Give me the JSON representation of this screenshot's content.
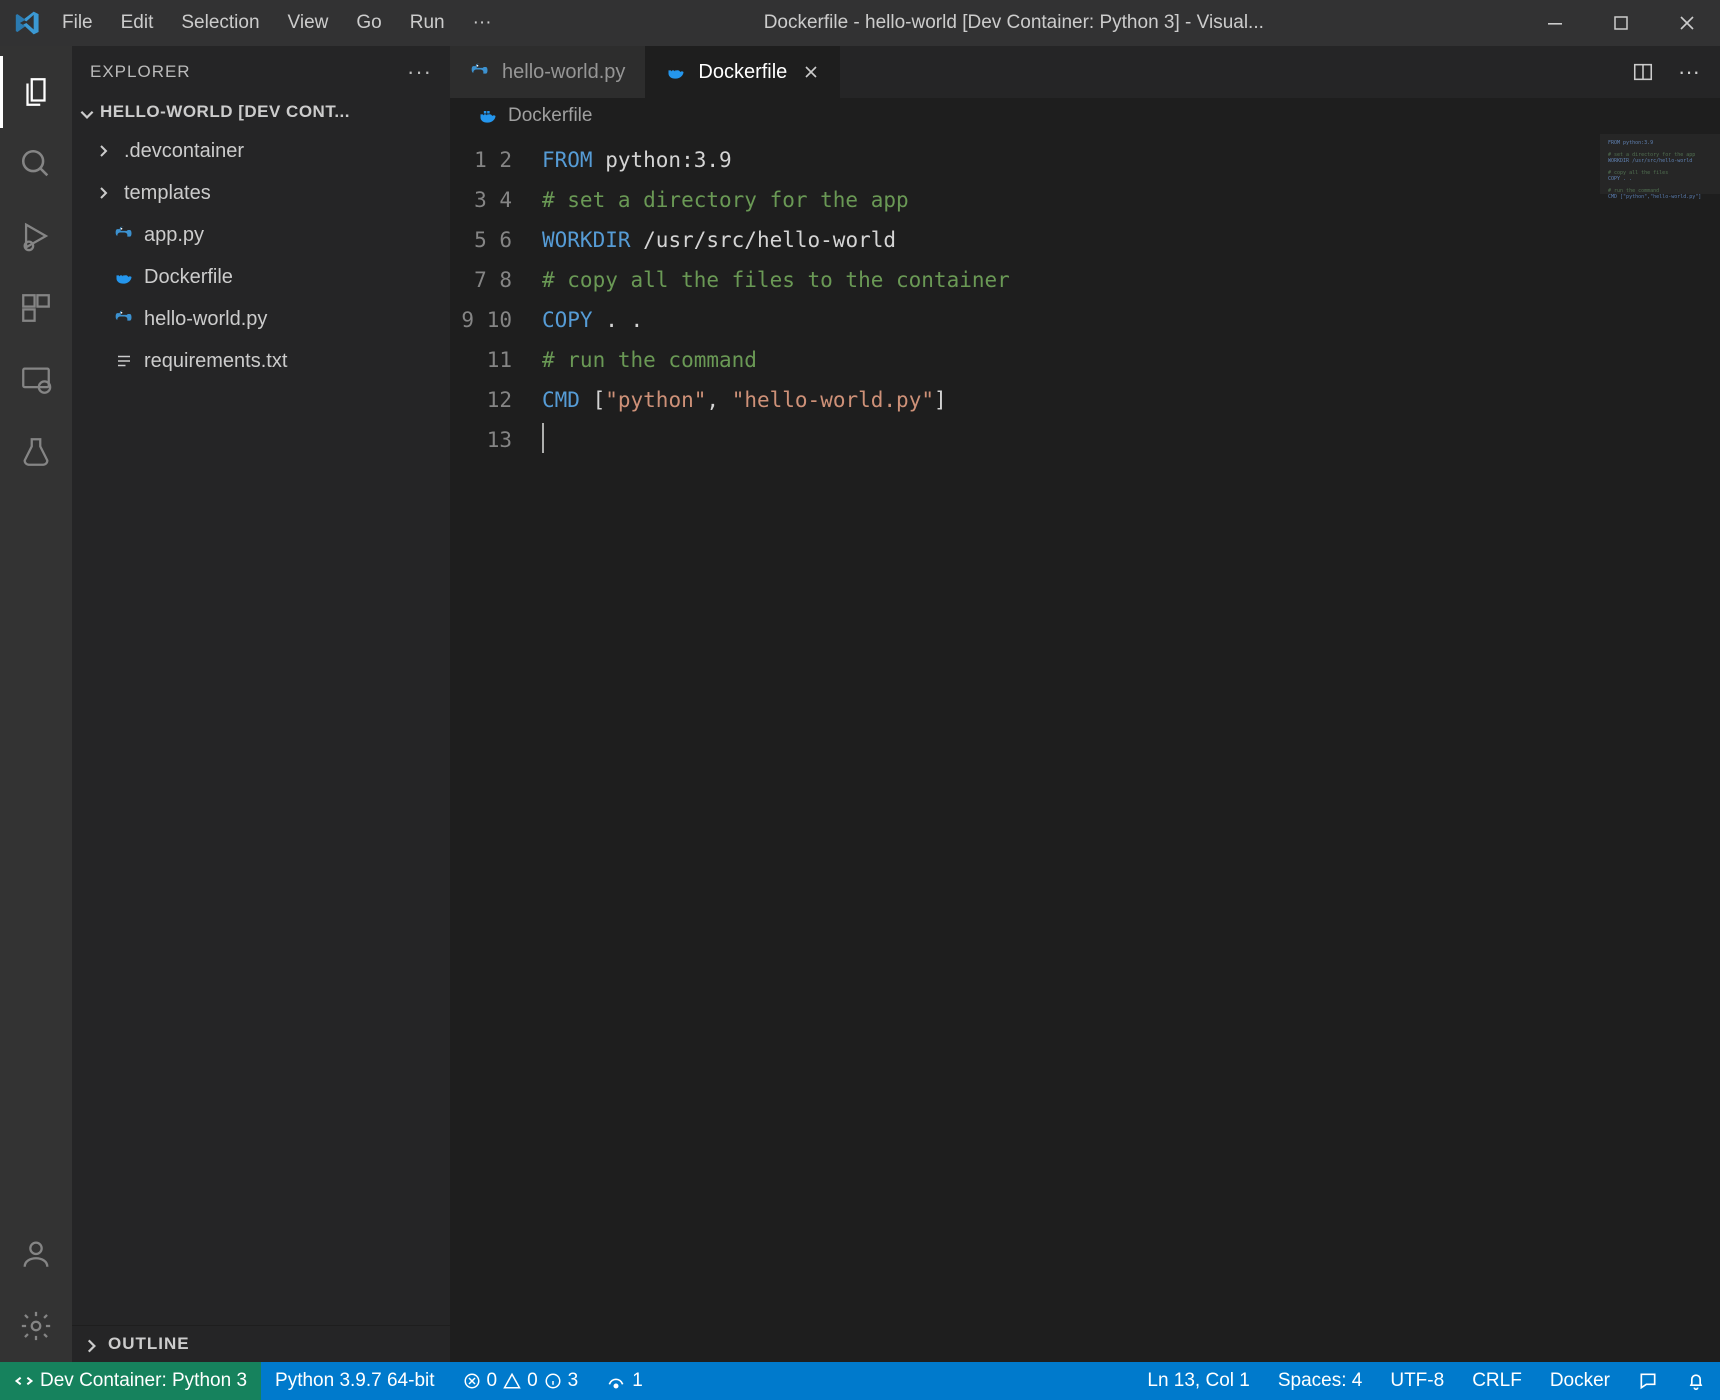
{
  "window": {
    "title": "Dockerfile - hello-world [Dev Container: Python 3] - Visual..."
  },
  "menu": [
    "File",
    "Edit",
    "Selection",
    "View",
    "Go",
    "Run",
    "···"
  ],
  "explorer": {
    "title": "EXPLORER",
    "project": "HELLO-WORLD [DEV CONT...",
    "items": [
      {
        "label": ".devcontainer",
        "kind": "folder"
      },
      {
        "label": "templates",
        "kind": "folder"
      },
      {
        "label": "app.py",
        "kind": "python"
      },
      {
        "label": "Dockerfile",
        "kind": "docker"
      },
      {
        "label": "hello-world.py",
        "kind": "python"
      },
      {
        "label": "requirements.txt",
        "kind": "lines"
      }
    ],
    "outline": "OUTLINE"
  },
  "tabs": [
    {
      "label": "hello-world.py",
      "kind": "python",
      "active": false
    },
    {
      "label": "Dockerfile",
      "kind": "docker",
      "active": true
    }
  ],
  "breadcrumb": {
    "kind": "docker",
    "label": "Dockerfile"
  },
  "code": {
    "total_lines": 13,
    "lines": [
      [
        {
          "t": "FROM",
          "c": "kw"
        },
        {
          "t": " python:3.9",
          "c": ""
        }
      ],
      [],
      [
        {
          "t": "# set a directory for the app",
          "c": "cmt"
        }
      ],
      [
        {
          "t": "WORKDIR",
          "c": "kw"
        },
        {
          "t": " /usr/src/hello-world",
          "c": ""
        }
      ],
      [],
      [
        {
          "t": "# copy all the files to the container",
          "c": "cmt"
        }
      ],
      [
        {
          "t": "COPY",
          "c": "kw"
        },
        {
          "t": " . .",
          "c": ""
        }
      ],
      [],
      [
        {
          "t": "# run the command",
          "c": "cmt"
        }
      ],
      [
        {
          "t": "CMD",
          "c": "kw"
        },
        {
          "t": " [",
          "c": ""
        },
        {
          "t": "\"python\"",
          "c": "str"
        },
        {
          "t": ", ",
          "c": ""
        },
        {
          "t": "\"hello-world.py\"",
          "c": "str"
        },
        {
          "t": "]",
          "c": ""
        }
      ],
      [],
      [],
      []
    ],
    "cursor_line": 13
  },
  "status": {
    "remote": "Dev Container: Python 3",
    "interpreter": "Python 3.9.7 64-bit",
    "errors": "0",
    "warnings": "0",
    "info": "3",
    "ports": "1",
    "cursor": "Ln 13, Col 1",
    "spaces": "Spaces: 4",
    "encoding": "UTF-8",
    "eol": "CRLF",
    "language": "Docker"
  }
}
